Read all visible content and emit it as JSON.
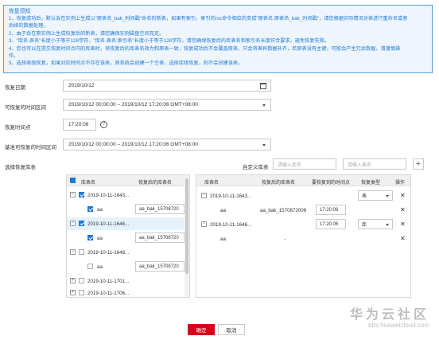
{
  "notice": {
    "title": "恢复须知",
    "lines": [
      "1、恢复成功后，默认会在实例上生成以\"原表名_bak_时间戳\"命名的新表，如果有索引，索引的rsc命令相应的变成\"原表名.原表名_bak_时间戳\"，请您根据实际情况对表进行重命名或者",
      "后续的数据处理。",
      "2、由于会在原实例上生成恢复后的新表，请您确保实例磁盘空间充足。",
      "3、\"库名.表名\"长度小于等于128字符，\"库名.表名.索引名\"长度小于等于128字符，请您确保恢复后的库表名和索引名长度符合要求，避免恢复失败。",
      "4、您也可以在提交恢复时间点内的库表时，将恢复后的库表名改为和原表一致，恢复成功后不会覆盖原表，只会将差异数据补齐，若原表没有主键，可能会产生冗余数据，请谨慎操",
      "作。",
      "5、选择表级恢复，如果对应时间点不存在该表，则系统会创建一个空表，选择库级恢复，则不会创建该表。"
    ]
  },
  "form": {
    "restore_date_label": "恢复日期",
    "restore_date_value": "2019/10/12",
    "available_range_label": "可恢复的时间区间",
    "available_range_value": "2019/10/12 00:00:00 – 2019/10/12 17:20:06 GMT+08:00",
    "time_point_label": "恢复时间点",
    "time_point_value": "17:20:06",
    "help_glyph": "?",
    "base_range_label": "基准可恢复的时间区间",
    "base_range_value": "2019/10/12 00:00:00 – 2019/10/12 17:20:06 GMT+08:00",
    "select_tables_label": "选择恢复库表",
    "custom_label": "自定义库表",
    "db_placeholder": "请输入库名",
    "table_placeholder": "请输入表名",
    "add_glyph": "+"
  },
  "left_table": {
    "headers": [
      "库表名",
      "恢复后的库表名"
    ],
    "rows": [
      {
        "name": "2019-10-11-1643...",
        "rename": "",
        "checked": true,
        "toggle": "−",
        "level": 0
      },
      {
        "name": "aa",
        "rename": "aa_bak_15708720",
        "checked": true,
        "toggle": "",
        "level": 1
      },
      {
        "name": "2019-10-11-1646...",
        "rename": "",
        "checked": true,
        "toggle": "−",
        "level": 0
      },
      {
        "name": "aa",
        "rename": "aa_bak_15708720",
        "checked": true,
        "toggle": "",
        "level": 1
      },
      {
        "name": "2019-10-11-1648...",
        "rename": "",
        "checked": false,
        "toggle": "−",
        "level": 0
      },
      {
        "name": "aa",
        "rename": "aa_bak_15708720",
        "checked": false,
        "toggle": "",
        "level": 1
      },
      {
        "name": "2019-10-11-1701...",
        "rename": "",
        "checked": false,
        "toggle": "+",
        "level": 0
      },
      {
        "name": "2019-10-11-1706...",
        "rename": "",
        "checked": false,
        "toggle": "+",
        "level": 0
      }
    ]
  },
  "right_table": {
    "headers": [
      "库表名",
      "恢复后的库表名",
      "要恢复到的时间点",
      "恢复类型",
      "操作"
    ],
    "rows": [
      {
        "name": "2019-10-11-1643...",
        "rename": "",
        "time": "",
        "type": "表",
        "toggle": "−",
        "level": 0
      },
      {
        "name": "aa",
        "rename": "aa_bak_1570872006",
        "time": "17:20:06",
        "type": "",
        "toggle": "",
        "level": 1
      },
      {
        "name": "2019-10-11-1646...",
        "rename": "",
        "time": "17:20:06",
        "type": "库",
        "toggle": "−",
        "level": 0
      },
      {
        "name": "aa",
        "rename": "-",
        "time": "",
        "type": "",
        "toggle": "",
        "level": 1
      }
    ],
    "remove_glyph": "✕"
  },
  "buttons": {
    "ok": "确定",
    "cancel": "取消"
  },
  "watermark": {
    "cn": "华为云社区",
    "url": "bbs.huaweicloud.com"
  }
}
